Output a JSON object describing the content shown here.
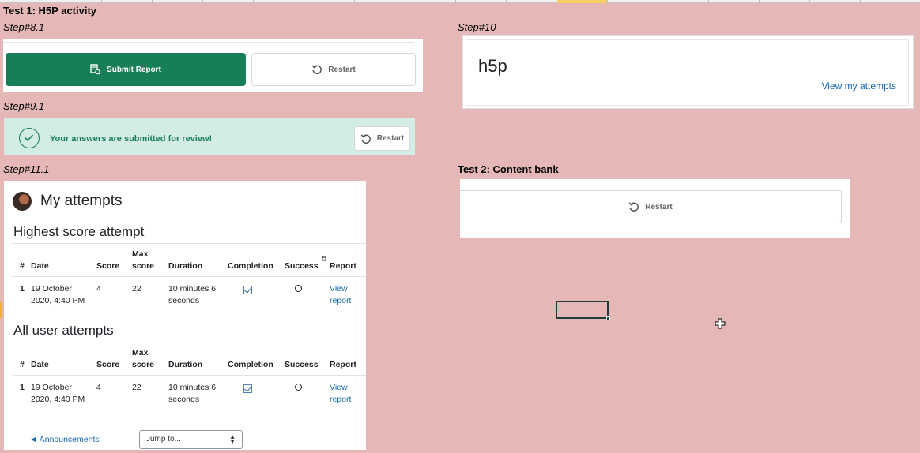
{
  "sheet": {
    "selected_column_color": "#f5cf63",
    "background_color": "#e5b8b7"
  },
  "labels": {
    "test1": "Test 1: H5P activity",
    "step8": "Step#8.1",
    "step9": "Step#9.1",
    "step10": "Step#10",
    "step11": "Step#11.1",
    "test2": "Test 2: Content bank"
  },
  "step8": {
    "submit_label": "Submit Report",
    "restart_label": "Restart",
    "submit_color": "#177e58"
  },
  "step9": {
    "message": "Your answers are submitted for review!",
    "restart_label": "Restart"
  },
  "step10": {
    "title": "h5p",
    "link": "View my attempts"
  },
  "step11": {
    "title": "My attempts",
    "highest_heading": "Highest score attempt",
    "all_heading": "All user attempts",
    "columns": {
      "idx": "#",
      "date": "Date",
      "score": "Score",
      "max_score": "Max score",
      "duration": "Duration",
      "completion": "Completion",
      "success": "Success",
      "report": "Report"
    },
    "highest_rows": [
      {
        "idx": "1",
        "date": "19 October 2020, 4:40 PM",
        "score": "4",
        "max_score": "22",
        "duration": "10 minutes 6 seconds",
        "completion": "checked",
        "success": "not-success",
        "report": "View report"
      }
    ],
    "all_rows": [
      {
        "idx": "1",
        "date": "19 October 2020, 4:40 PM",
        "score": "4",
        "max_score": "22",
        "duration": "10 minutes 6 seconds",
        "completion": "checked",
        "success": "not-success",
        "report": "View report"
      }
    ],
    "prev_link": "◄ Announcements",
    "jump_to": "Jump to..."
  },
  "content_bank": {
    "restart_label": "Restart"
  }
}
